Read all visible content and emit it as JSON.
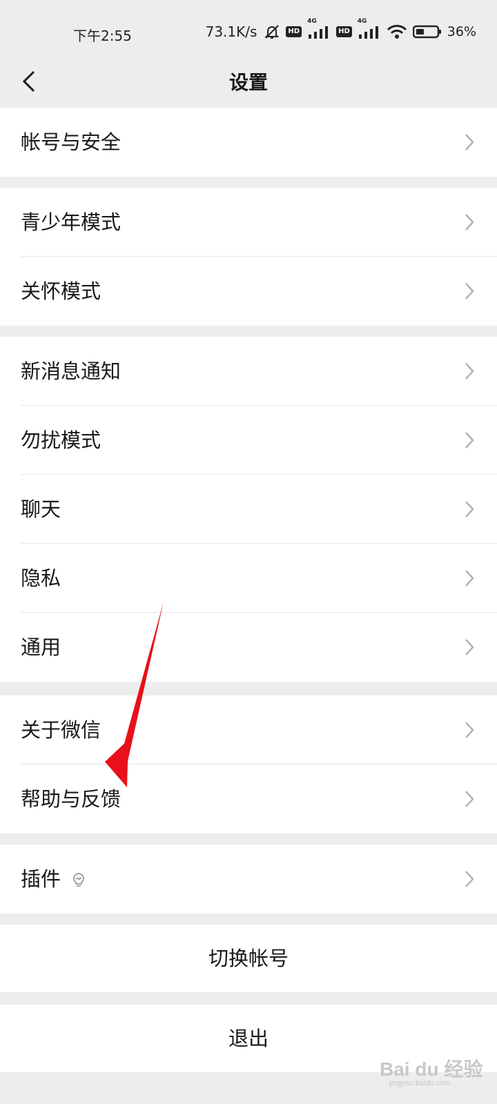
{
  "status_bar": {
    "time": "下午2:55",
    "net_speed": "73.1K/s",
    "sim1_tag": "4G",
    "sim2_tag": "4G",
    "hd_label": "HD",
    "battery": "36%"
  },
  "header": {
    "title": "设置"
  },
  "groups": [
    {
      "items": [
        {
          "label": "帐号与安全"
        }
      ]
    },
    {
      "items": [
        {
          "label": "青少年模式"
        },
        {
          "label": "关怀模式"
        }
      ]
    },
    {
      "items": [
        {
          "label": "新消息通知"
        },
        {
          "label": "勿扰模式"
        },
        {
          "label": "聊天"
        },
        {
          "label": "隐私"
        },
        {
          "label": "通用"
        }
      ]
    },
    {
      "items": [
        {
          "label": "关于微信"
        },
        {
          "label": "帮助与反馈"
        }
      ]
    },
    {
      "items": [
        {
          "label": "插件"
        }
      ]
    }
  ],
  "actions": {
    "switch_account": "切换帐号",
    "logout": "退出"
  },
  "colors": {
    "background": "#ededed",
    "card": "#ffffff",
    "divider": "#e5e5e5",
    "arrow_annotation": "#e8101a"
  },
  "watermark": {
    "text": "Bai du 经验",
    "sub": "jingyan.baidu.com"
  }
}
